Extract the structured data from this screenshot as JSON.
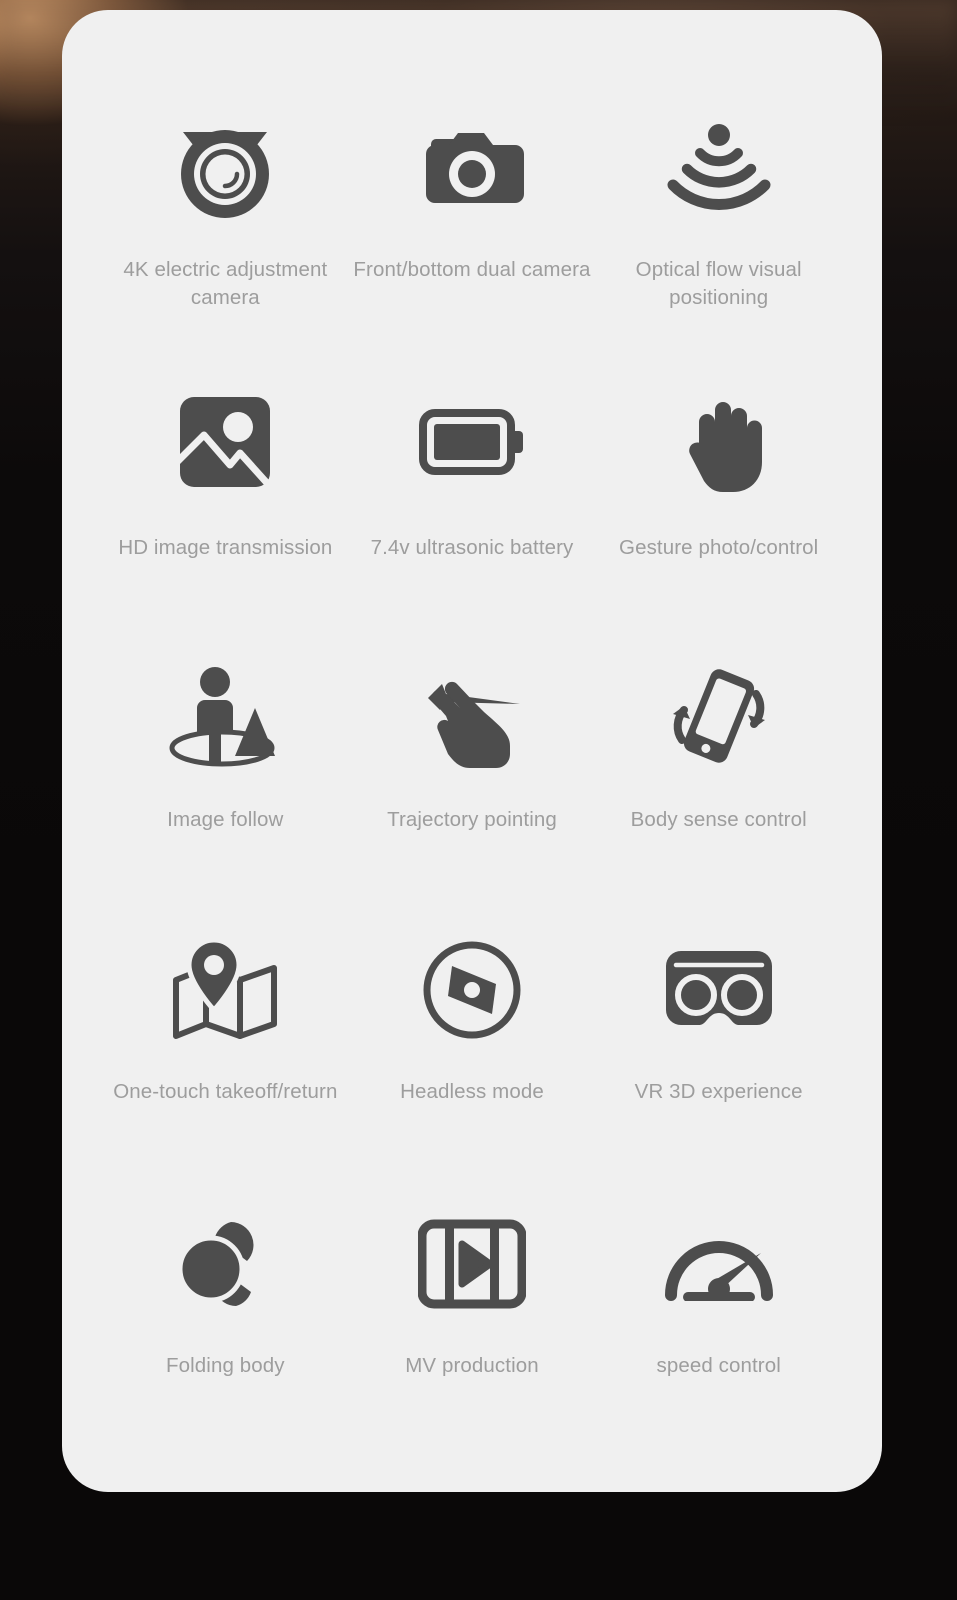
{
  "background": {
    "base_color": "#0a0808",
    "highlight_color": "#d6a06e"
  },
  "card": {
    "background_color": "#f0f0f0",
    "icon_color": "#4d4d4d",
    "label_color": "#9d9d9d",
    "features": [
      {
        "icon": "dome-camera-icon",
        "label": "4K electric adjustment camera"
      },
      {
        "icon": "photo-camera-icon",
        "label": "Front/bottom dual camera"
      },
      {
        "icon": "optical-flow-waves-icon",
        "label": "Optical flow visual positioning"
      },
      {
        "icon": "image-picture-icon",
        "label": "HD image transmission"
      },
      {
        "icon": "battery-icon",
        "label": "7.4v ultrasonic battery"
      },
      {
        "icon": "open-hand-icon",
        "label": "Gesture photo/control"
      },
      {
        "icon": "person-follow-icon",
        "label": "Image follow"
      },
      {
        "icon": "hand-swipe-icon",
        "label": "Trajectory pointing"
      },
      {
        "icon": "tilt-phone-icon",
        "label": "Body sense control"
      },
      {
        "icon": "map-pin-icon",
        "label": "One-touch takeoff/return"
      },
      {
        "icon": "compass-icon",
        "label": "Headless mode"
      },
      {
        "icon": "vr-goggles-icon",
        "label": "VR 3D experience"
      },
      {
        "icon": "folding-body-icon",
        "label": "Folding body"
      },
      {
        "icon": "film-play-icon",
        "label": "MV production"
      },
      {
        "icon": "speedometer-icon",
        "label": "speed control"
      }
    ]
  }
}
